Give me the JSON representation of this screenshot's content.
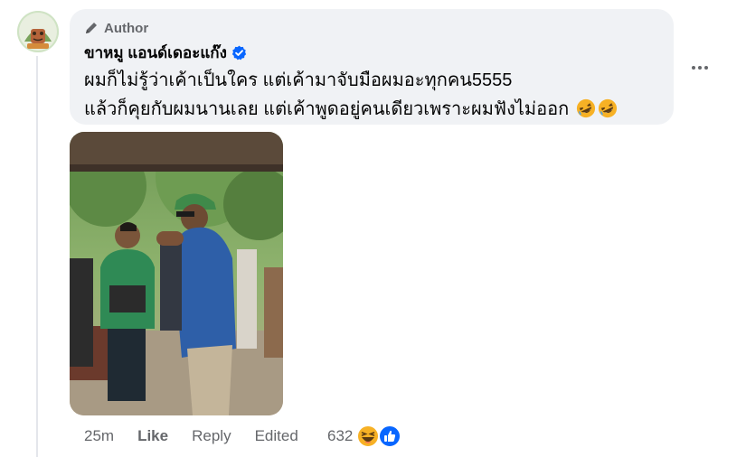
{
  "comment": {
    "author_badge": "Author",
    "author_name": "ขาหมู แอนด์เดอะแก๊ง",
    "message_line1": "ผมก็ไม่รู้ว่าเค้าเป็นใคร แต่เค้ามาจับมือผมอะทุกคน5555",
    "message_line2": "แล้วก็คุยกับผมนานเลย แต่เค้าพูดอยู่คนเดียวเพราะผมฟังไม่ออก",
    "message_emojis": [
      "rolling-on-floor-laughing-emoji",
      "rolling-on-floor-laughing-emoji"
    ],
    "verified_color": "#0866ff"
  },
  "actions": {
    "time": "25m",
    "like": "Like",
    "reply": "Reply",
    "edited": "Edited"
  },
  "reactions": {
    "count": "632",
    "icons": [
      "haha-reaction-icon",
      "like-reaction-icon"
    ],
    "like_color": "#0866ff",
    "haha_color": "#f7b125"
  },
  "icons": {
    "author_badge_icon": "pencil-icon",
    "more_icon": "more-options-icon"
  }
}
